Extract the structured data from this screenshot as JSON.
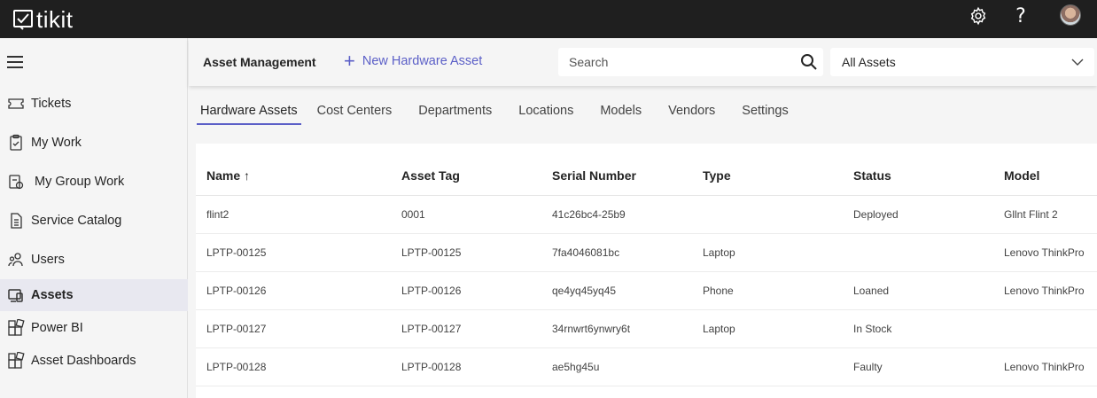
{
  "app": {
    "name": "tikit"
  },
  "sidebar": {
    "items": [
      {
        "label": "Tickets",
        "icon": "ticket-icon"
      },
      {
        "label": "My Work",
        "icon": "clipboard-icon"
      },
      {
        "label": "My Group Work",
        "icon": "group-work-icon"
      },
      {
        "label": "Service Catalog",
        "icon": "catalog-icon"
      },
      {
        "label": "Users",
        "icon": "users-icon"
      },
      {
        "label": "Assets",
        "icon": "assets-icon",
        "active": true
      },
      {
        "label": "Power BI",
        "icon": "powerbi-icon"
      },
      {
        "label": "Asset Dashboards",
        "icon": "dashboard-icon"
      }
    ]
  },
  "header": {
    "title": "Asset Management",
    "new_asset_label": "New Hardware Asset",
    "search_placeholder": "Search",
    "filter_value": "All Assets"
  },
  "tabs": [
    "Hardware Assets",
    "Cost Centers",
    "Departments",
    "Locations",
    "Models",
    "Vendors",
    "Settings"
  ],
  "table": {
    "columns": [
      "Name ↑",
      "Asset Tag",
      "Serial Number",
      "Type",
      "Status",
      "Model"
    ],
    "rows": [
      [
        "flint2",
        "0001",
        "41c26bc4-25b9",
        "",
        "Deployed",
        "Gllnt Flint 2"
      ],
      [
        "LPTP-00125",
        "LPTP-00125",
        "7fa4046081bc",
        "Laptop",
        "",
        "Lenovo ThinkPro"
      ],
      [
        "LPTP-00126",
        "LPTP-00126",
        "qe4yq45yq45",
        "Phone",
        "Loaned",
        "Lenovo ThinkPro"
      ],
      [
        "LPTP-00127",
        "LPTP-00127",
        "34rnwrt6ynwry6t",
        "Laptop",
        "In Stock",
        ""
      ],
      [
        "LPTP-00128",
        "LPTP-00128",
        "ae5hg45u",
        "",
        "Faulty",
        "Lenovo ThinkPro"
      ]
    ]
  },
  "colors": {
    "accent": "#5b5fc7",
    "topbar": "#1f1f1f",
    "active_nav": "#e8e8f0"
  }
}
